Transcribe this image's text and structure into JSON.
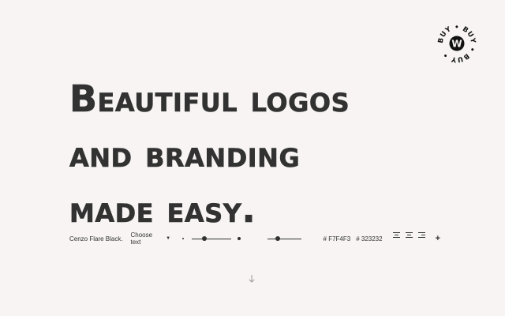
{
  "badge": {
    "ring_text": "BUY • BUY • BUY • ",
    "letter": "W"
  },
  "headline": {
    "lines": [
      "Beautiful logos",
      "and branding",
      "made easy."
    ]
  },
  "toolbar": {
    "font_name": "Cenzo Flare Black…",
    "choose_text": "Choose text",
    "font_size_level": 0.33,
    "line_height_level": 0.3,
    "background_color": "# F7F4F3",
    "text_color": "# 323232"
  },
  "colors": {
    "background": "#F7F4F3",
    "text": "#323232"
  },
  "icons": {
    "scroll": "arrow-down-icon",
    "add": "plus-icon"
  }
}
